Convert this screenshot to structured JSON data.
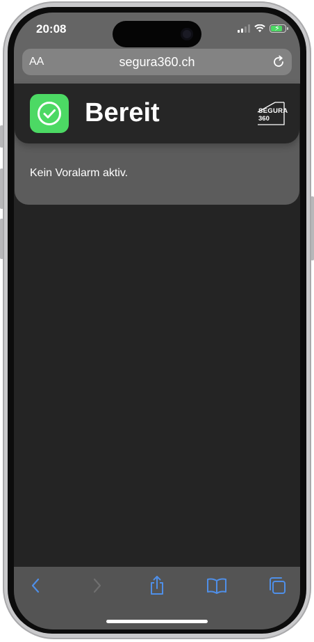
{
  "status_bar": {
    "time": "20:08"
  },
  "browser": {
    "text_size_label": "AA",
    "url": "segura360.ch"
  },
  "alarm_card": {
    "status_title": "Bereit",
    "message": "Kein Voralarm aktiv.",
    "logo": {
      "top": "SEGURA",
      "bottom": "360"
    }
  },
  "toolbar": {
    "icons": [
      "chevron-left-icon",
      "chevron-right-icon",
      "share-icon",
      "bookmarks-icon",
      "tabs-icon"
    ]
  },
  "colors": {
    "accent": "#4cd964",
    "toolbar_icon": "#4f8fe8",
    "toolbar_icon_disabled": "#6f6f6f"
  }
}
